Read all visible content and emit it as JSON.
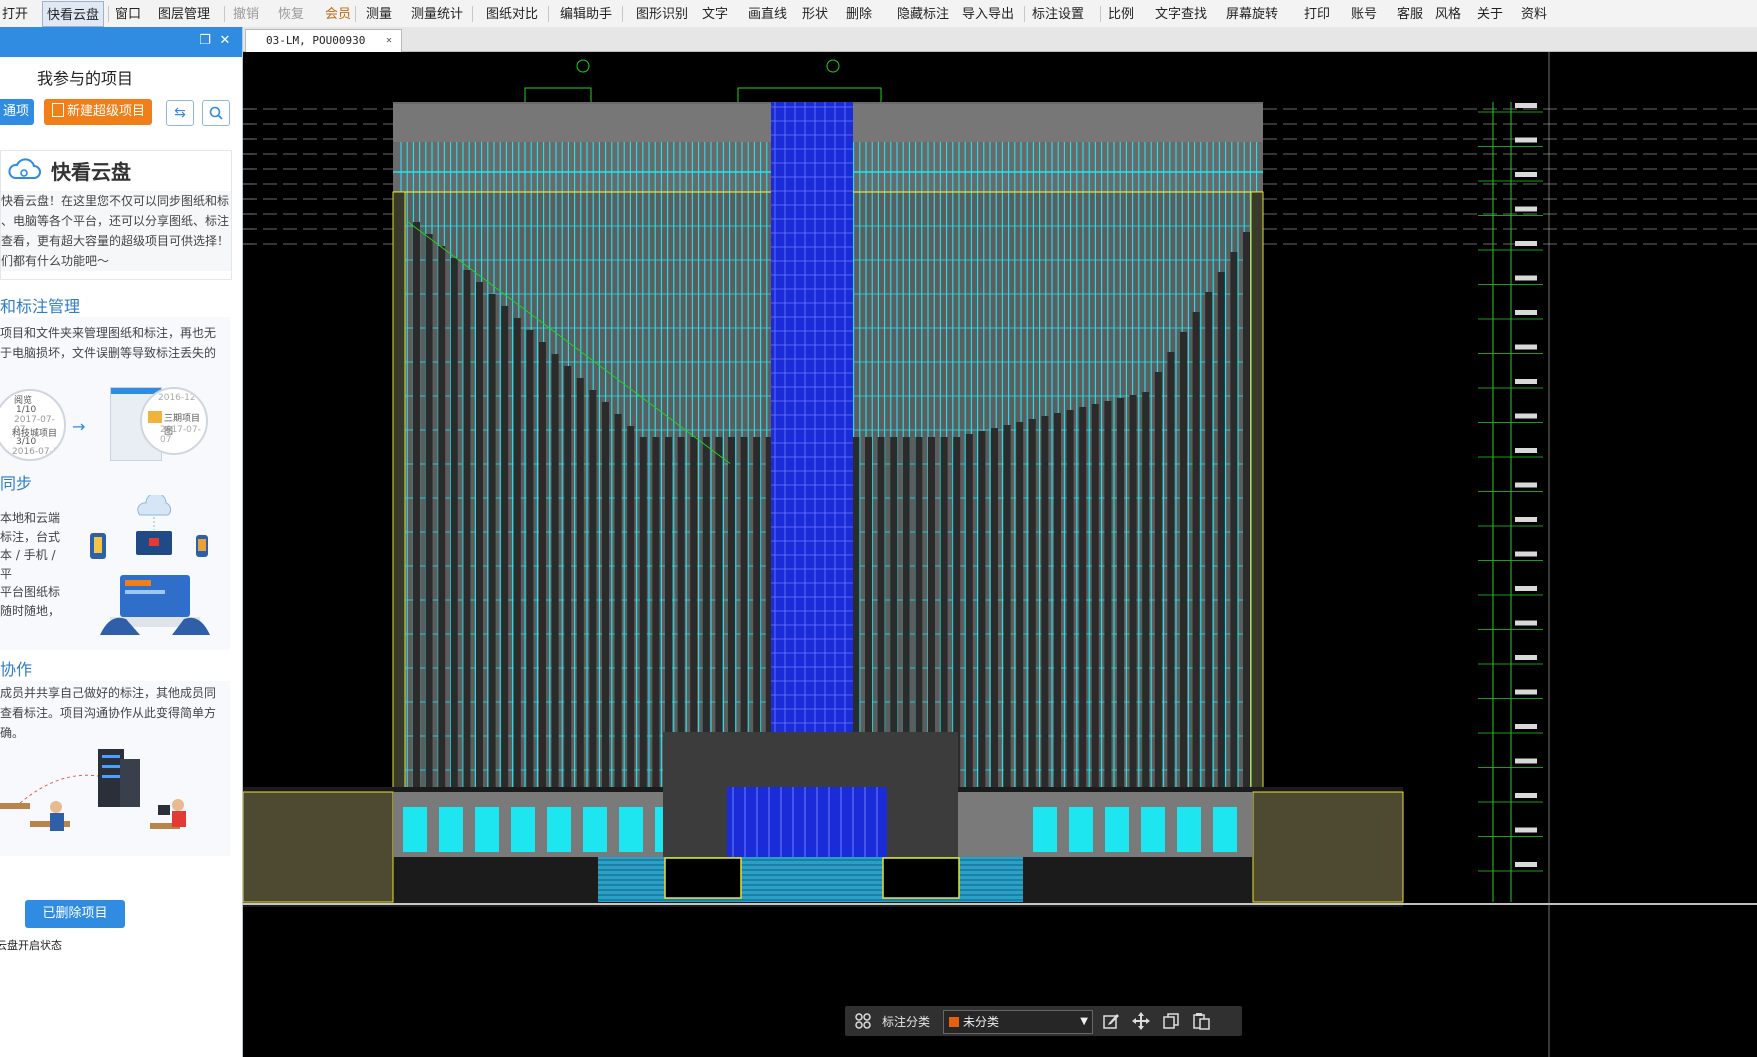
{
  "menu": [
    {
      "label": "打开",
      "state": "normal"
    },
    {
      "label": "快看云盘",
      "state": "active"
    },
    {
      "label": "窗口",
      "state": "normal"
    },
    {
      "label": "图层管理",
      "state": "normal"
    },
    {
      "label": "撤销",
      "state": "disabled"
    },
    {
      "label": "恢复",
      "state": "disabled"
    },
    {
      "label": "会员",
      "state": "member"
    },
    {
      "label": "测量",
      "state": "normal"
    },
    {
      "label": "测量统计",
      "state": "normal"
    },
    {
      "label": "图纸对比",
      "state": "normal"
    },
    {
      "label": "编辑助手",
      "state": "normal"
    },
    {
      "label": "图形识别",
      "state": "normal"
    },
    {
      "label": "文字",
      "state": "normal"
    },
    {
      "label": "画直线",
      "state": "normal"
    },
    {
      "label": "形状",
      "state": "normal"
    },
    {
      "label": "删除",
      "state": "normal"
    },
    {
      "label": "隐藏标注",
      "state": "normal"
    },
    {
      "label": "导入导出",
      "state": "normal"
    },
    {
      "label": "标注设置",
      "state": "normal"
    },
    {
      "label": "比例",
      "state": "normal"
    },
    {
      "label": "文字查找",
      "state": "normal"
    },
    {
      "label": "屏幕旋转",
      "state": "normal"
    },
    {
      "label": "打印",
      "state": "normal"
    },
    {
      "label": "账号",
      "state": "normal"
    },
    {
      "label": "客服",
      "state": "normal"
    },
    {
      "label": "风格",
      "state": "normal"
    },
    {
      "label": "关于",
      "state": "normal"
    },
    {
      "label": "资料",
      "state": "normal"
    }
  ],
  "panel": {
    "title": "我参与的项目",
    "btn_project_partial": "通项目",
    "btn_new_super": "新建超级项目",
    "cloud_title": "快看云盘",
    "cloud_desc": [
      "快看云盘！在这里您不仅可以同步图纸和标",
      "、电脑等各个平台，还可以分享图纸、标注",
      "查看，更有超大容量的超级项目可供选择！",
      "们都有什么功能吧～"
    ],
    "sec1_title": "和标注管理",
    "sec1_desc": [
      "项目和文件夹来管理图纸和标注，再也无",
      "于电脑损坏，文件误删等导致标注丢失的"
    ],
    "sec1_card_a": [
      "阅览",
      "1/10",
      "2017-07-07",
      "科技城项目",
      "3/10",
      "2016-07-1"
    ],
    "sec1_card_b": [
      "2016-12",
      "三期项目图",
      "2017-07-07"
    ],
    "sec2_title": "同步",
    "sec2_desc": [
      "本地和云端",
      "标注，台式",
      "本 / 手机 / 平",
      "平台图纸标",
      "随时随地，"
    ],
    "sec3_title": "协作",
    "sec3_desc": [
      "成员并共享自己做好的标注，其他成员同",
      "查看标注。项目沟通协作从此变得简单方",
      "确。"
    ],
    "deleted_btn": "已删除项目",
    "footer": "云盘开启状态"
  },
  "tab": {
    "label": "03-LM, POU00930",
    "close": "✕"
  },
  "float_toolbar": {
    "category_label": "标注分类",
    "category_value": "未分类",
    "category_color": "#e8600c"
  },
  "colors": {
    "accent": "#2f8ce0",
    "orange": "#f07f1a",
    "cyan": "#1ee6f0",
    "blue": "#2a3ff0",
    "yellow": "#e8e030",
    "green": "#22d022",
    "canvas": "#000000"
  },
  "icons": [
    "restore-icon",
    "close-icon",
    "sync-icon",
    "search-icon",
    "cloud-icon",
    "grid-icon",
    "edit-icon",
    "move-icon",
    "copy-icon",
    "paste-icon",
    "dropdown-arrow-icon"
  ]
}
